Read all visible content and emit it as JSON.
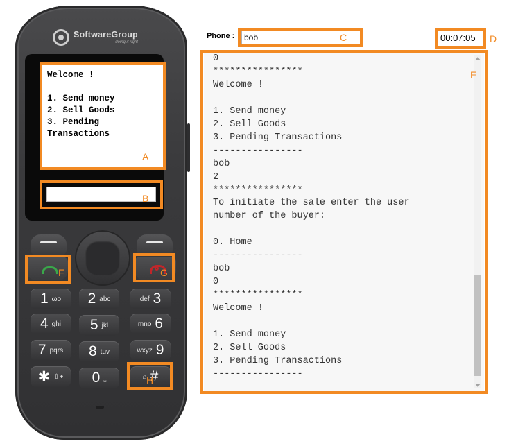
{
  "phone": {
    "brand_name": "SoftwareGroup",
    "brand_tagline": "doing it right",
    "screen_text": "Welcome !\n\n1. Send money\n2. Sell Goods\n3. Pending\nTransactions",
    "reply_input_value": "",
    "keys": [
      {
        "num": "1",
        "sub": "ωο"
      },
      {
        "num": "2",
        "sub": "abc"
      },
      {
        "num": "3",
        "sub": "def"
      },
      {
        "num": "4",
        "sub": "ghi"
      },
      {
        "num": "5",
        "sub": "jkl"
      },
      {
        "num": "6",
        "sub": "mno"
      },
      {
        "num": "7",
        "sub": "pqrs"
      },
      {
        "num": "8",
        "sub": "tuv"
      },
      {
        "num": "9",
        "sub": "wxyz"
      },
      {
        "num": "✱",
        "sub": "⇧+"
      },
      {
        "num": "0",
        "sub": "⎵"
      },
      {
        "num": "#",
        "sub": "⌂"
      }
    ],
    "icons": {
      "call": "call-green-icon",
      "end": "end-call-red-icon",
      "logo": "softwaregroup-logo-icon"
    }
  },
  "panel": {
    "phone_label": "Phone :",
    "phone_value": "bob",
    "timer": "00:07:05",
    "console_text": "0\n****************\nWelcome !\n\n1. Send money\n2. Sell Goods\n3. Pending Transactions\n----------------\nbob\n2\n****************\nTo initiate the sale enter the user\nnumber of the buyer:\n\n0. Home\n----------------\nbob\n0\n****************\nWelcome !\n\n1. Send money\n2. Sell Goods\n3. Pending Transactions\n----------------"
  },
  "annotations": {
    "A": "A",
    "B": "B",
    "C": "C",
    "D": "D",
    "E": "E",
    "F": "F",
    "G": "G",
    "H": "H"
  },
  "colors": {
    "annotation": "#f28a23",
    "phone_body": "#3b3b3d",
    "call_green": "#3aa84a",
    "end_red": "#c0262a"
  }
}
